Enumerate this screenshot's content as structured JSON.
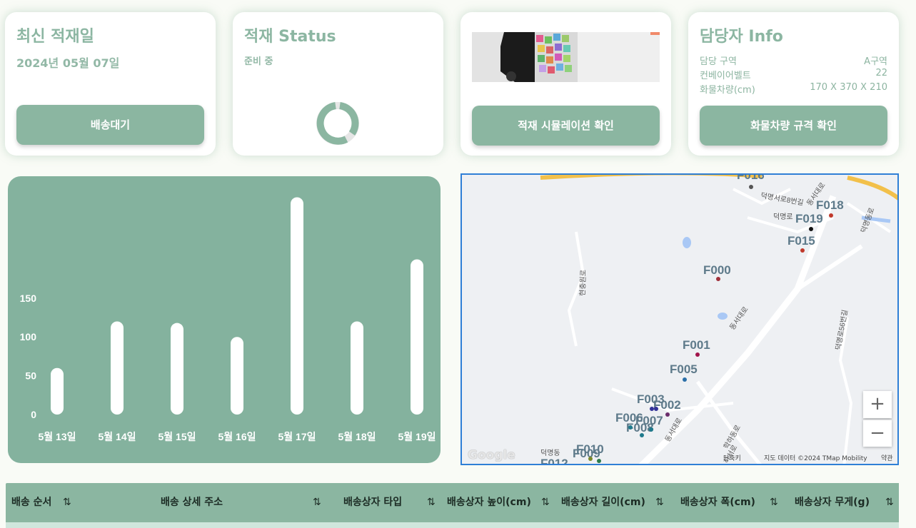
{
  "cards": {
    "latest": {
      "title": "최신 적재일",
      "date": "2024년 05월 07일",
      "button": "배송대기"
    },
    "status": {
      "title": "적재 Status",
      "sub": "준비 중"
    },
    "sim": {
      "button": "적재 시뮬레이션 확인"
    },
    "manager": {
      "title": "담당자 Info",
      "rows": [
        {
          "label": "담당 구역",
          "value": "A구역"
        },
        {
          "label": "컨베이어벨트",
          "value": "22"
        },
        {
          "label": "화물차량(cm)",
          "value": "170 X 370 X 210"
        }
      ],
      "button": "화물차량 규격 확인"
    }
  },
  "chart_data": {
    "type": "bar",
    "categories": [
      "5월 13일",
      "5월 14일",
      "5월 15일",
      "5월 16일",
      "5월 17일",
      "5월 18일",
      "5월 19일"
    ],
    "values": [
      60,
      120,
      118,
      100,
      280,
      120,
      200
    ],
    "yticks": [
      0,
      50,
      100,
      150
    ],
    "ylim": [
      0,
      285
    ],
    "colors": {
      "panel": "#84b29e",
      "bar": "#ffffff"
    }
  },
  "map": {
    "markers": [
      "F016",
      "F018",
      "F019",
      "F015",
      "F000",
      "F001",
      "F005",
      "F003",
      "F002",
      "F006",
      "F007",
      "F008",
      "F010",
      "F009",
      "F012"
    ],
    "roads": [
      "덕명서로8번길",
      "동서대로",
      "덕명로",
      "덕명동로",
      "현충원로",
      "동서대로",
      "덕명로56번길",
      "학하동로",
      "덕명동",
      "하서로",
      "동서대로"
    ],
    "zoom_in": "+",
    "zoom_out": "−",
    "google": "Google",
    "footer": [
      "단축키",
      "지도 데이터 ©2024 TMap Mobility",
      "약관"
    ]
  },
  "table": {
    "headers": [
      "배송 순서",
      "배송 상세 주소",
      "배송상자 타입",
      "배송상자 높이(cm)",
      "배송상자 길이(cm)",
      "배송상자 폭(cm)",
      "배송상자 무게(g)"
    ],
    "sort_icon": "⇅"
  }
}
